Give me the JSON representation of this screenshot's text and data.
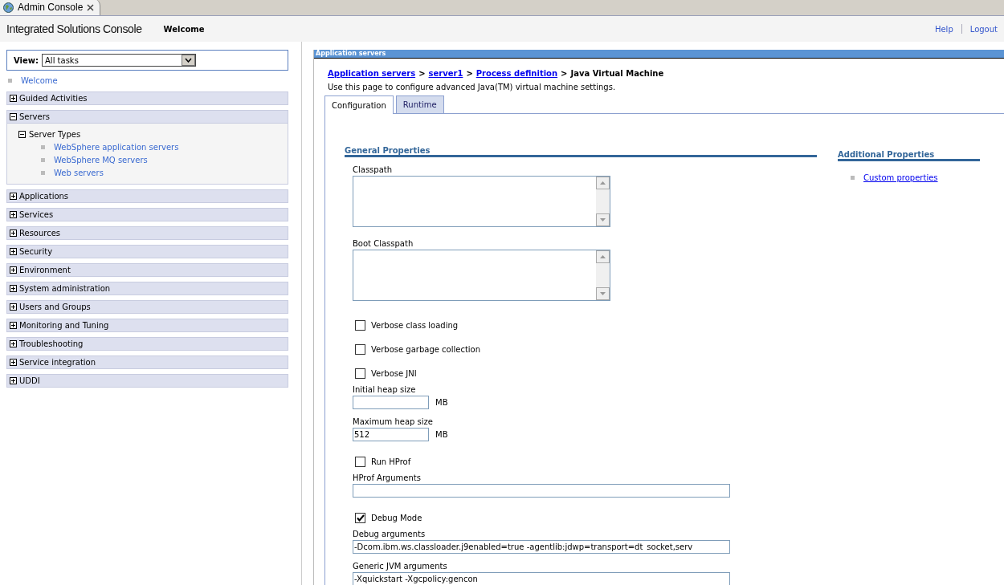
{
  "browser_tab": {
    "title": "Admin Console"
  },
  "header": {
    "product": "Integrated Solutions Console",
    "page": "Welcome",
    "links": [
      "Help",
      "Logout"
    ]
  },
  "nav": {
    "view_label": "View:",
    "view_value": "All tasks",
    "welcome": "Welcome",
    "sections": [
      {
        "label": "Guided Activities",
        "expanded": false
      },
      {
        "label": "Servers",
        "expanded": true,
        "children": [
          {
            "label": "Server Types",
            "expanded": true,
            "children": [
              {
                "label": "WebSphere application servers"
              },
              {
                "label": "WebSphere MQ servers"
              },
              {
                "label": "Web servers"
              }
            ]
          }
        ]
      },
      {
        "label": "Applications",
        "expanded": false
      },
      {
        "label": "Services",
        "expanded": false
      },
      {
        "label": "Resources",
        "expanded": false
      },
      {
        "label": "Security",
        "expanded": false
      },
      {
        "label": "Environment",
        "expanded": false
      },
      {
        "label": "System administration",
        "expanded": false
      },
      {
        "label": "Users and Groups",
        "expanded": false
      },
      {
        "label": "Monitoring and Tuning",
        "expanded": false
      },
      {
        "label": "Troubleshooting",
        "expanded": false
      },
      {
        "label": "Service integration",
        "expanded": false
      },
      {
        "label": "UDDI",
        "expanded": false
      }
    ]
  },
  "content": {
    "panel_title": "Application servers",
    "breadcrumb": [
      {
        "label": "Application servers",
        "link": true
      },
      {
        "label": "server1",
        "link": true
      },
      {
        "label": "Process definition",
        "link": true
      },
      {
        "label": "Java Virtual Machine",
        "link": false
      }
    ],
    "breadcrumb_separator": ">",
    "description": "Use this page to configure advanced Java(TM) virtual machine settings.",
    "tabs": [
      {
        "label": "Configuration",
        "selected": true
      },
      {
        "label": "Runtime",
        "selected": false
      }
    ],
    "general_title": "General Properties",
    "fields": [
      {
        "kind": "textarea",
        "label": "Classpath"
      },
      {
        "kind": "textarea",
        "label": "Boot Classpath"
      },
      {
        "kind": "checkbox",
        "label": "Verbose class loading",
        "checked": false
      },
      {
        "kind": "checkbox",
        "label": "Verbose garbage collection",
        "checked": false
      },
      {
        "kind": "checkbox",
        "label": "Verbose JNI",
        "checked": false
      },
      {
        "kind": "short",
        "label": "Initial heap size",
        "unit": "MB"
      },
      {
        "kind": "short",
        "label": "Maximum heap size",
        "value": "512",
        "unit": "MB"
      },
      {
        "kind": "checkbox",
        "label": "Run HProf",
        "checked": false
      },
      {
        "kind": "long",
        "label": "HProf Arguments"
      },
      {
        "kind": "checkbox",
        "label": "Debug Mode",
        "checked": true
      },
      {
        "kind": "long",
        "label": "Debug arguments",
        "value": "-Dcom.ibm.ws.classloader.j9enabled=true -agentlib:jdwp=transport=dt_socket,serv"
      },
      {
        "kind": "long",
        "label": "Generic JVM arguments",
        "value": "-Xquickstart -Xgcpolicy:gencon"
      }
    ],
    "additional_title": "Additional Properties",
    "additional_links": [
      "Custom properties"
    ]
  }
}
